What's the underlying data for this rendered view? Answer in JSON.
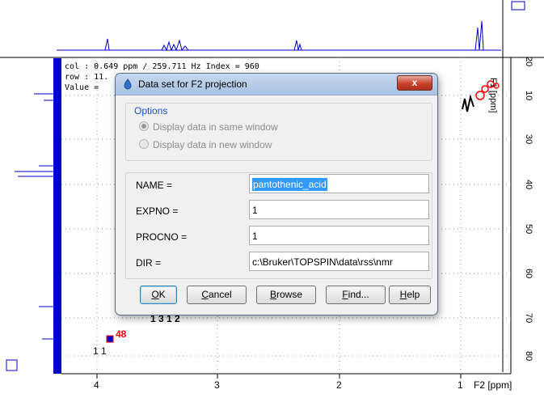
{
  "spectrum": {
    "x_tick_labels": [
      "4",
      "3",
      "2",
      "1"
    ],
    "x_axis_label": "F2 [ppm]",
    "y_axis_label": "F1 [ppm]",
    "y_tick_labels": [
      "10",
      "20",
      "30",
      "40",
      "50",
      "60",
      "70",
      "80"
    ],
    "peak_labels": {
      "p48": "48",
      "l1": "1 1",
      "l2": "1 3 1 2"
    },
    "colors": {
      "axis": "#000000",
      "projection": "#0000cc",
      "peak_red": "#ff0000"
    }
  },
  "cursor_info": {
    "col_line": "col : 0.649 ppm / 259.711 Hz Index = 960",
    "row_line": "row : 11.",
    "value_line": "Value ="
  },
  "dialog": {
    "title": "Data set for F2 projection",
    "close_glyph": "x",
    "options_legend": "Options",
    "option_same": "Display data in same window",
    "option_new": "Display data in new window",
    "fields": [
      {
        "label": "NAME =",
        "value": "pantothenic_acid"
      },
      {
        "label": "EXPNO =",
        "value": "1"
      },
      {
        "label": "PROCNO =",
        "value": "1"
      },
      {
        "label": "DIR =",
        "value": "c:\\Bruker\\TOPSPIN\\data\\rss\\nmr"
      }
    ],
    "buttons": {
      "ok_u": "O",
      "ok_rest": "K",
      "cancel_u": "C",
      "cancel_rest": "ancel",
      "browse_u": "B",
      "browse_rest": "rowse",
      "find_u": "F",
      "find_rest": "ind...",
      "help_u": "H",
      "help_rest": "elp"
    }
  }
}
